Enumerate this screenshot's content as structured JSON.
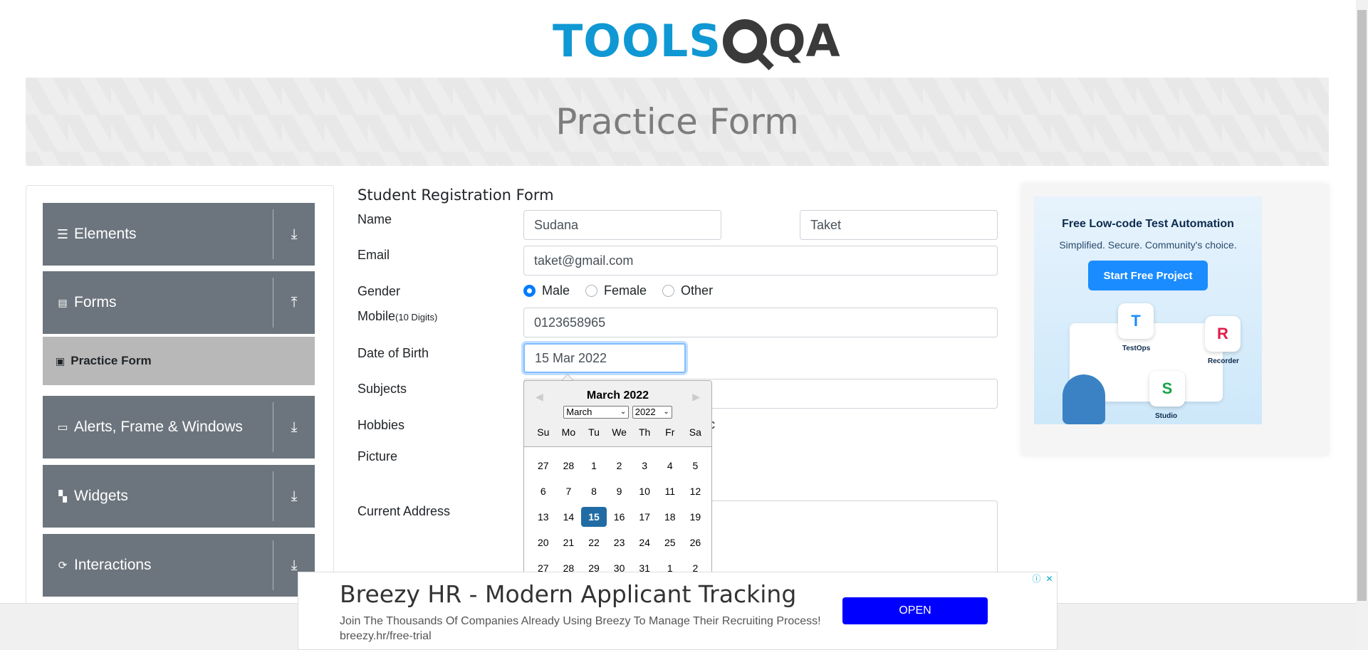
{
  "logo": {
    "text_part": "TOOLS",
    "qa_part": "QA"
  },
  "banner": {
    "title": "Practice Form"
  },
  "sidebar": {
    "groups": [
      {
        "label": "Elements",
        "icon": "hamburger-icon",
        "toggle": "down-arrow-icon"
      },
      {
        "label": "Forms",
        "icon": "document-icon",
        "toggle": "up-arrow-icon"
      },
      {
        "label": "Alerts, Frame & Windows",
        "icon": "window-icon",
        "toggle": "down-arrow-icon"
      },
      {
        "label": "Widgets",
        "icon": "widgets-icon",
        "toggle": "down-arrow-icon"
      },
      {
        "label": "Interactions",
        "icon": "interactions-icon",
        "toggle": "down-arrow-icon"
      }
    ],
    "active_item": {
      "label": "Practice Form",
      "icon": "form-icon"
    }
  },
  "form": {
    "title": "Student Registration Form",
    "labels": {
      "name": "Name",
      "email": "Email",
      "gender": "Gender",
      "mobile": "Mobile",
      "mobile_hint": "(10 Digits)",
      "dob": "Date of Birth",
      "subjects": "Subjects",
      "hobbies": "Hobbies",
      "picture": "Picture",
      "address": "Current Address"
    },
    "values": {
      "first_name": "Sudana",
      "last_name": "Taket",
      "email": "taket@gmail.com",
      "mobile": "0123658965",
      "dob": "15 Mar 2022"
    },
    "gender_options": [
      "Male",
      "Female",
      "Other"
    ],
    "gender_selected": "Male",
    "hobby_tail": "c"
  },
  "datepicker": {
    "title": "March 2022",
    "month_select": "March",
    "year_select": "2022",
    "prev_label": "◀",
    "next_label": "▶",
    "weekdays": [
      "Su",
      "Mo",
      "Tu",
      "We",
      "Th",
      "Fr",
      "Sa"
    ],
    "weeks": [
      [
        "27",
        "28",
        "1",
        "2",
        "3",
        "4",
        "5"
      ],
      [
        "6",
        "7",
        "8",
        "9",
        "10",
        "11",
        "12"
      ],
      [
        "13",
        "14",
        "15",
        "16",
        "17",
        "18",
        "19"
      ],
      [
        "20",
        "21",
        "22",
        "23",
        "24",
        "25",
        "26"
      ],
      [
        "27",
        "28",
        "29",
        "30",
        "31",
        "1",
        "2"
      ]
    ],
    "selected_day": "15"
  },
  "ad_right": {
    "title": "Free Low-code Test Automation",
    "subtitle": "Simplified. Secure. Community's choice.",
    "button": "Start Free Project",
    "tiles": [
      "TestOps",
      "Recorder",
      "Studio"
    ]
  },
  "bottom_ad": {
    "title": "Breezy HR - Modern Applicant Tracking",
    "description": "Join The Thousands Of Companies Already Using Breezy To Manage Their Recruiting Process! breezy.hr/free-trial",
    "button": "OPEN"
  },
  "colors": {
    "brand_blue": "#0f98d3",
    "sidebar_group": "#6c757d",
    "active_item": "#b8b8b8",
    "radio_checked": "#007bff",
    "datepicker_selected": "#216ba5",
    "ad_button": "#0000ff"
  }
}
